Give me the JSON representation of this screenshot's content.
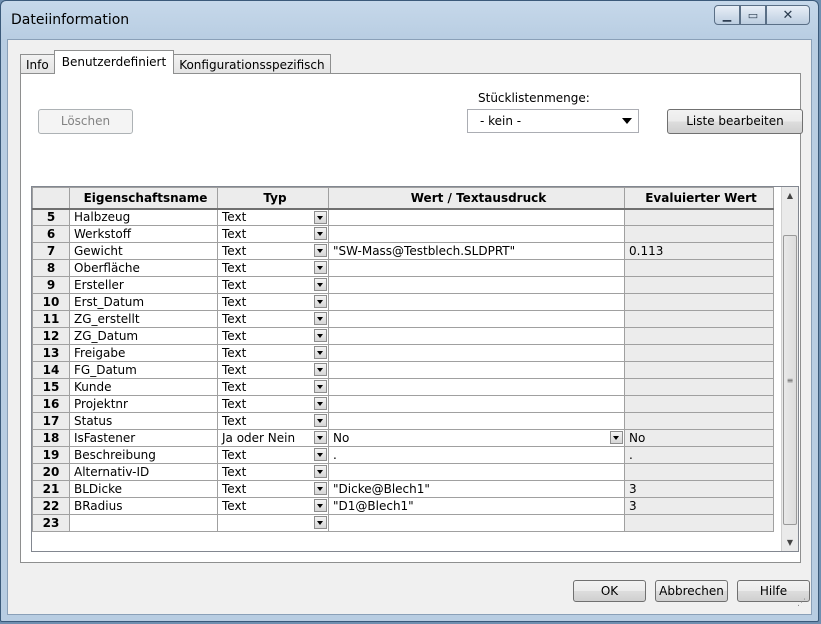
{
  "window": {
    "title": "Dateiinformation"
  },
  "tabs": [
    {
      "label": "Info",
      "active": false
    },
    {
      "label": "Benutzerdefiniert",
      "active": true
    },
    {
      "label": "Konfigurationsspezifisch",
      "active": false
    }
  ],
  "toolbar": {
    "delete_label": "Löschen",
    "bom_quantity_label": "Stücklistenmenge:",
    "bom_quantity_value": "- kein -",
    "edit_list_label": "Liste bearbeiten"
  },
  "grid": {
    "headers": [
      "",
      "Eigenschaftsname",
      "Typ",
      "Wert / Textausdruck",
      "Evaluierter Wert"
    ],
    "rows": [
      {
        "n": "5",
        "name": "Halbzeug",
        "type": "Text",
        "value": "",
        "eval": ""
      },
      {
        "n": "6",
        "name": "Werkstoff",
        "type": "Text",
        "value": "",
        "eval": ""
      },
      {
        "n": "7",
        "name": "Gewicht",
        "type": "Text",
        "value": "\"SW-Mass@Testblech.SLDPRT\"",
        "eval": "0.113"
      },
      {
        "n": "8",
        "name": "Oberfläche",
        "type": "Text",
        "value": "",
        "eval": ""
      },
      {
        "n": "9",
        "name": "Ersteller",
        "type": "Text",
        "value": "",
        "eval": ""
      },
      {
        "n": "10",
        "name": "Erst_Datum",
        "type": "Text",
        "value": "",
        "eval": ""
      },
      {
        "n": "11",
        "name": "ZG_erstellt",
        "type": "Text",
        "value": "",
        "eval": ""
      },
      {
        "n": "12",
        "name": "ZG_Datum",
        "type": "Text",
        "value": "",
        "eval": ""
      },
      {
        "n": "13",
        "name": "Freigabe",
        "type": "Text",
        "value": "",
        "eval": ""
      },
      {
        "n": "14",
        "name": "FG_Datum",
        "type": "Text",
        "value": "",
        "eval": ""
      },
      {
        "n": "15",
        "name": "Kunde",
        "type": "Text",
        "value": "",
        "eval": ""
      },
      {
        "n": "16",
        "name": "Projektnr",
        "type": "Text",
        "value": "",
        "eval": ""
      },
      {
        "n": "17",
        "name": "Status",
        "type": "Text",
        "value": "",
        "eval": ""
      },
      {
        "n": "18",
        "name": "IsFastener",
        "type": "Ja oder Nein",
        "value": "No",
        "eval": "No",
        "value_dropdown": true
      },
      {
        "n": "19",
        "name": "Beschreibung",
        "type": "Text",
        "value": ".",
        "eval": "."
      },
      {
        "n": "20",
        "name": "Alternativ-ID",
        "type": "Text",
        "value": "",
        "eval": ""
      },
      {
        "n": "21",
        "name": "BLDicke",
        "type": "Text",
        "value": "\"Dicke@Blech1\"",
        "eval": "3"
      },
      {
        "n": "22",
        "name": "BRadius",
        "type": "Text",
        "value": "\"D1@Blech1\"",
        "eval": "3"
      },
      {
        "n": "23",
        "name": "",
        "type": "",
        "value": "",
        "eval": ""
      }
    ]
  },
  "footer": {
    "ok_label": "OK",
    "cancel_label": "Abbrechen",
    "help_label": "Hilfe"
  },
  "icons": {
    "minimize": "minimize-icon",
    "maximize": "maximize-icon",
    "close": "close-icon"
  }
}
